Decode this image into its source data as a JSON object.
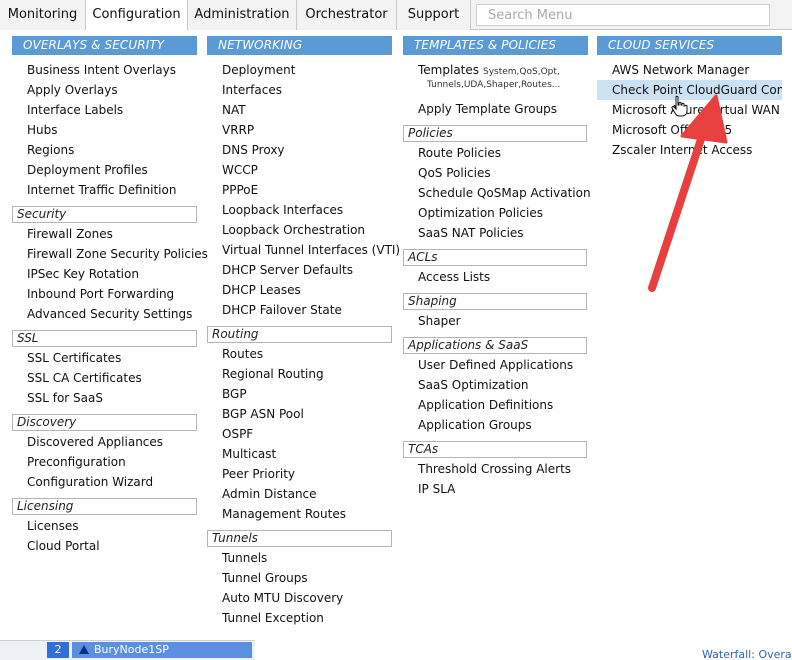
{
  "topnav": {
    "tabs": [
      "Monitoring",
      "Configuration",
      "Administration",
      "Orchestrator",
      "Support"
    ],
    "active_index": 1,
    "search_placeholder": "Search Menu"
  },
  "columns": [
    {
      "title": "OVERLAYS & SECURITY",
      "items": [
        "Business Intent Overlays",
        "Apply Overlays",
        "Interface Labels",
        "Hubs",
        "Regions",
        "Deployment Profiles",
        "Internet Traffic Definition"
      ],
      "sections": [
        {
          "title": "Security",
          "items": [
            "Firewall Zones",
            "Firewall Zone Security Policies",
            "IPSec Key Rotation",
            "Inbound Port Forwarding",
            "Advanced Security Settings"
          ]
        },
        {
          "title": "SSL",
          "items": [
            "SSL Certificates",
            "SSL CA Certificates",
            "SSL for SaaS"
          ]
        },
        {
          "title": "Discovery",
          "items": [
            "Discovered Appliances",
            "Preconfiguration",
            "Configuration Wizard"
          ]
        },
        {
          "title": "Licensing",
          "items": [
            "Licenses",
            "Cloud Portal"
          ]
        }
      ]
    },
    {
      "title": "NETWORKING",
      "items": [
        "Deployment",
        "Interfaces",
        "NAT",
        "VRRP",
        "DNS Proxy",
        "WCCP",
        "PPPoE",
        "Loopback Interfaces",
        "Loopback Orchestration",
        "Virtual Tunnel Interfaces (VTI)",
        "DHCP Server Defaults",
        "DHCP Leases",
        "DHCP Failover State"
      ],
      "sections": [
        {
          "title": "Routing",
          "items": [
            "Routes",
            "Regional Routing",
            "BGP",
            "BGP ASN Pool",
            "OSPF",
            "Multicast",
            "Peer Priority",
            "Admin Distance",
            "Management Routes"
          ]
        },
        {
          "title": "Tunnels",
          "items": [
            "Tunnels",
            "Tunnel Groups",
            "Auto MTU Discovery",
            "Tunnel Exception"
          ]
        }
      ]
    },
    {
      "title": "TEMPLATES & POLICIES",
      "templates": {
        "label": "Templates",
        "note_line1": "System,QoS,Opt,",
        "note_line2": "Tunnels,UDA,Shaper,Routes..."
      },
      "items": [
        "Apply Template Groups"
      ],
      "sections": [
        {
          "title": "Policies",
          "items": [
            "Route Policies",
            "QoS Policies",
            "Schedule QoSMap Activation",
            "Optimization Policies",
            "SaaS NAT Policies"
          ]
        },
        {
          "title": "ACLs",
          "items": [
            "Access Lists"
          ]
        },
        {
          "title": "Shaping",
          "items": [
            "Shaper"
          ]
        },
        {
          "title": "Applications & SaaS",
          "items": [
            "User Defined Applications",
            "SaaS Optimization",
            "Application Definitions",
            "Application Groups"
          ]
        },
        {
          "title": "TCAs",
          "items": [
            "Threshold Crossing Alerts",
            "IP SLA"
          ]
        }
      ]
    },
    {
      "title": "CLOUD SERVICES",
      "items": [
        "AWS Network Manager",
        "Check Point CloudGuard Connect",
        "Microsoft Azure Virtual WAN",
        "Microsoft Office 365",
        "Zscaler Internet Access"
      ],
      "highlighted_index": 1
    }
  ],
  "bottom": {
    "badge": "2",
    "node_label": "BuryNode1SP",
    "waterfall": "Waterfall: Overall Q"
  },
  "colors": {
    "header": "#5b9bd5",
    "highlight": "#cce1f4",
    "annotation_arrow": "#e8403f"
  }
}
